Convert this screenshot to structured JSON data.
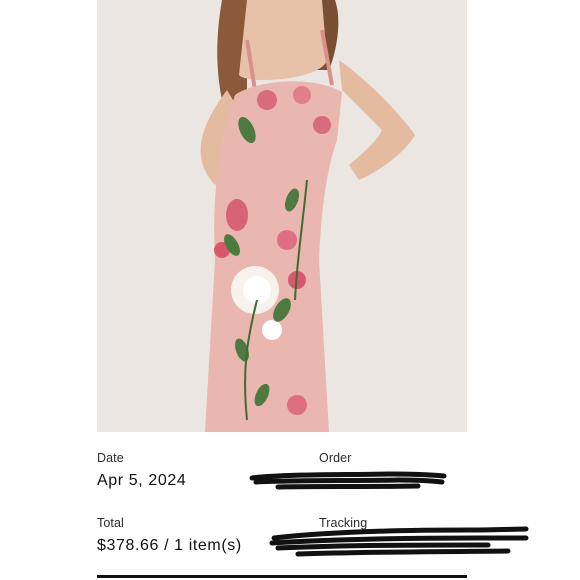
{
  "product": {
    "image": {
      "description_icon": "floral-dress-photo"
    }
  },
  "order_info": {
    "date": {
      "label": "Date",
      "value": "Apr 5, 2024"
    },
    "order": {
      "label": "Order",
      "value_redacted": true
    },
    "total": {
      "label": "Total",
      "value": "$378.66 / 1 item(s)"
    },
    "tracking": {
      "label": "Tracking",
      "value_redacted": true
    }
  },
  "colors": {
    "dress_pink": "#e9b6b0",
    "background": "#ece7e3",
    "text": "#111111",
    "redaction": "#111111"
  }
}
